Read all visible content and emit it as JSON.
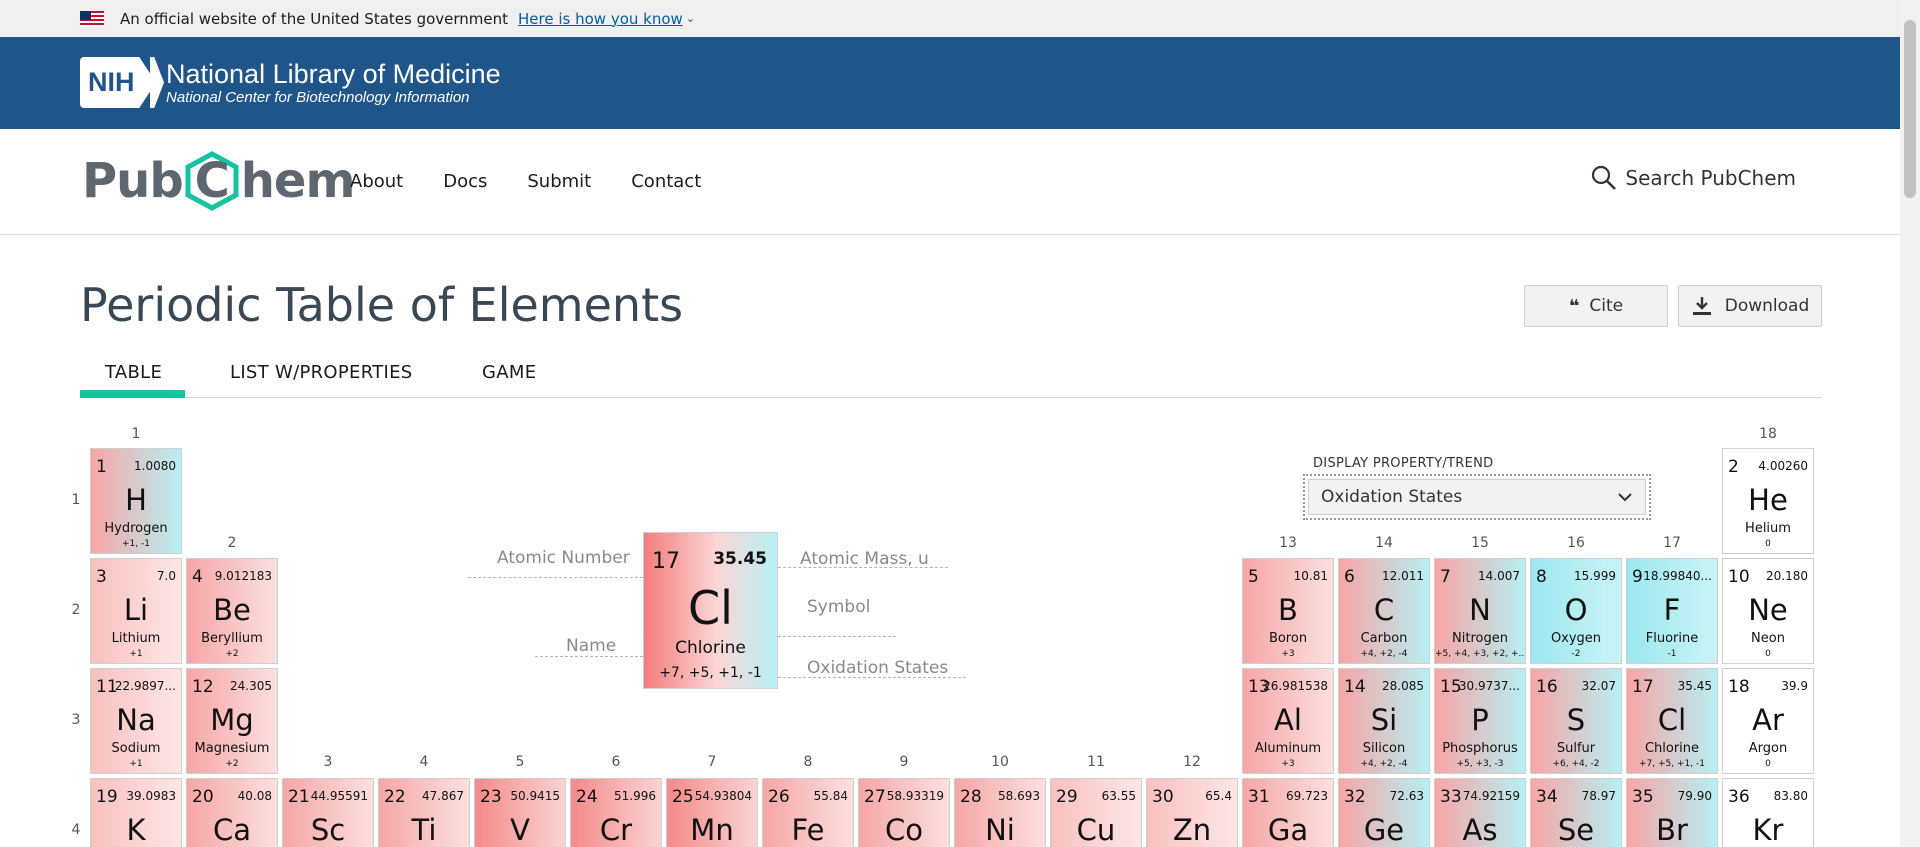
{
  "gov_banner": {
    "text": "An official website of the United States government",
    "link": "Here is how you know"
  },
  "nlm": {
    "badge": "NIH",
    "title": "National Library of Medicine",
    "subtitle": "National Center for Biotechnology Information"
  },
  "pubchem": {
    "logo_left": "Pub",
    "logo_c": "C",
    "logo_right": "hem",
    "nav": [
      "About",
      "Docs",
      "Submit",
      "Contact"
    ],
    "search_label": "Search PubChem"
  },
  "page": {
    "title": "Periodic Table of Elements",
    "cite_label": "Cite",
    "download_label": "Download",
    "tabs": [
      "TABLE",
      "LIST W/PROPERTIES",
      "GAME"
    ],
    "active_tab": "TABLE"
  },
  "display_property": {
    "label": "DISPLAY PROPERTY/TREND",
    "value": "Oxidation States"
  },
  "key": {
    "number": "17",
    "mass": "35.45",
    "symbol": "Cl",
    "name": "Chlorine",
    "oxidation": "+7, +5, +1, -1",
    "labels": {
      "atomic_number": "Atomic Number",
      "atomic_mass": "Atomic Mass, u",
      "symbol": "Symbol",
      "name": "Name",
      "oxidation": "Oxidation States"
    }
  },
  "group_labels": [
    "1",
    "2",
    "3",
    "4",
    "5",
    "6",
    "7",
    "8",
    "9",
    "10",
    "11",
    "12",
    "13",
    "14",
    "15",
    "16",
    "17",
    "18"
  ],
  "period_labels": [
    "1",
    "2",
    "3",
    "4"
  ],
  "elements": [
    {
      "n": "1",
      "mass": "1.0080",
      "sym": "H",
      "name": "Hydrogen",
      "ox": "+1, -1",
      "color": "mix"
    },
    {
      "n": "2",
      "mass": "4.00260",
      "sym": "He",
      "name": "Helium",
      "ox": "0",
      "color": "white"
    },
    {
      "n": "3",
      "mass": "7.0",
      "sym": "Li",
      "name": "Lithium",
      "ox": "+1",
      "color": "light"
    },
    {
      "n": "4",
      "mass": "9.012183",
      "sym": "Be",
      "name": "Beryllium",
      "ox": "+2",
      "color": "pink"
    },
    {
      "n": "5",
      "mass": "10.81",
      "sym": "B",
      "name": "Boron",
      "ox": "+3",
      "color": "pink"
    },
    {
      "n": "6",
      "mass": "12.011",
      "sym": "C",
      "name": "Carbon",
      "ox": "+4, +2, -4",
      "color": "mix"
    },
    {
      "n": "7",
      "mass": "14.007",
      "sym": "N",
      "name": "Nitrogen",
      "ox": "+5, +4, +3, +2, +...",
      "color": "mix"
    },
    {
      "n": "8",
      "mass": "15.999",
      "sym": "O",
      "name": "Oxygen",
      "ox": "-2",
      "color": "cyan"
    },
    {
      "n": "9",
      "mass": "18.99840...",
      "sym": "F",
      "name": "Fluorine",
      "ox": "-1",
      "color": "cyan"
    },
    {
      "n": "10",
      "mass": "20.180",
      "sym": "Ne",
      "name": "Neon",
      "ox": "0",
      "color": "white"
    },
    {
      "n": "11",
      "mass": "22.9897...",
      "sym": "Na",
      "name": "Sodium",
      "ox": "+1",
      "color": "light"
    },
    {
      "n": "12",
      "mass": "24.305",
      "sym": "Mg",
      "name": "Magnesium",
      "ox": "+2",
      "color": "pink"
    },
    {
      "n": "13",
      "mass": "26.981538",
      "sym": "Al",
      "name": "Aluminum",
      "ox": "+3",
      "color": "pink"
    },
    {
      "n": "14",
      "mass": "28.085",
      "sym": "Si",
      "name": "Silicon",
      "ox": "+4, +2, -4",
      "color": "mix"
    },
    {
      "n": "15",
      "mass": "30.9737...",
      "sym": "P",
      "name": "Phosphorus",
      "ox": "+5, +3, -3",
      "color": "mix"
    },
    {
      "n": "16",
      "mass": "32.07",
      "sym": "S",
      "name": "Sulfur",
      "ox": "+6, +4, -2",
      "color": "mix"
    },
    {
      "n": "17",
      "mass": "35.45",
      "sym": "Cl",
      "name": "Chlorine",
      "ox": "+7, +5, +1, -1",
      "color": "mix"
    },
    {
      "n": "18",
      "mass": "39.9",
      "sym": "Ar",
      "name": "Argon",
      "ox": "0",
      "color": "white"
    },
    {
      "n": "19",
      "mass": "39.0983",
      "sym": "K",
      "name": "",
      "ox": "",
      "color": "light"
    },
    {
      "n": "20",
      "mass": "40.08",
      "sym": "Ca",
      "name": "",
      "ox": "",
      "color": "pink"
    },
    {
      "n": "21",
      "mass": "44.95591",
      "sym": "Sc",
      "name": "",
      "ox": "",
      "color": "pink"
    },
    {
      "n": "22",
      "mass": "47.867",
      "sym": "Ti",
      "name": "",
      "ox": "",
      "color": "pink"
    },
    {
      "n": "23",
      "mass": "50.9415",
      "sym": "V",
      "name": "",
      "ox": "",
      "color": "red"
    },
    {
      "n": "24",
      "mass": "51.996",
      "sym": "Cr",
      "name": "",
      "ox": "",
      "color": "red"
    },
    {
      "n": "25",
      "mass": "54.93804",
      "sym": "Mn",
      "name": "",
      "ox": "",
      "color": "red"
    },
    {
      "n": "26",
      "mass": "55.84",
      "sym": "Fe",
      "name": "",
      "ox": "",
      "color": "pink"
    },
    {
      "n": "27",
      "mass": "58.93319",
      "sym": "Co",
      "name": "",
      "ox": "",
      "color": "pink"
    },
    {
      "n": "28",
      "mass": "58.693",
      "sym": "Ni",
      "name": "",
      "ox": "",
      "color": "pink"
    },
    {
      "n": "29",
      "mass": "63.55",
      "sym": "Cu",
      "name": "",
      "ox": "",
      "color": "light"
    },
    {
      "n": "30",
      "mass": "65.4",
      "sym": "Zn",
      "name": "",
      "ox": "",
      "color": "light"
    },
    {
      "n": "31",
      "mass": "69.723",
      "sym": "Ga",
      "name": "",
      "ox": "",
      "color": "pink"
    },
    {
      "n": "32",
      "mass": "72.63",
      "sym": "Ge",
      "name": "",
      "ox": "",
      "color": "mix"
    },
    {
      "n": "33",
      "mass": "74.92159",
      "sym": "As",
      "name": "",
      "ox": "",
      "color": "mix"
    },
    {
      "n": "34",
      "mass": "78.97",
      "sym": "Se",
      "name": "",
      "ox": "",
      "color": "mix"
    },
    {
      "n": "35",
      "mass": "79.90",
      "sym": "Br",
      "name": "",
      "ox": "",
      "color": "mix"
    },
    {
      "n": "36",
      "mass": "83.80",
      "sym": "Kr",
      "name": "",
      "ox": "",
      "color": "white"
    }
  ]
}
